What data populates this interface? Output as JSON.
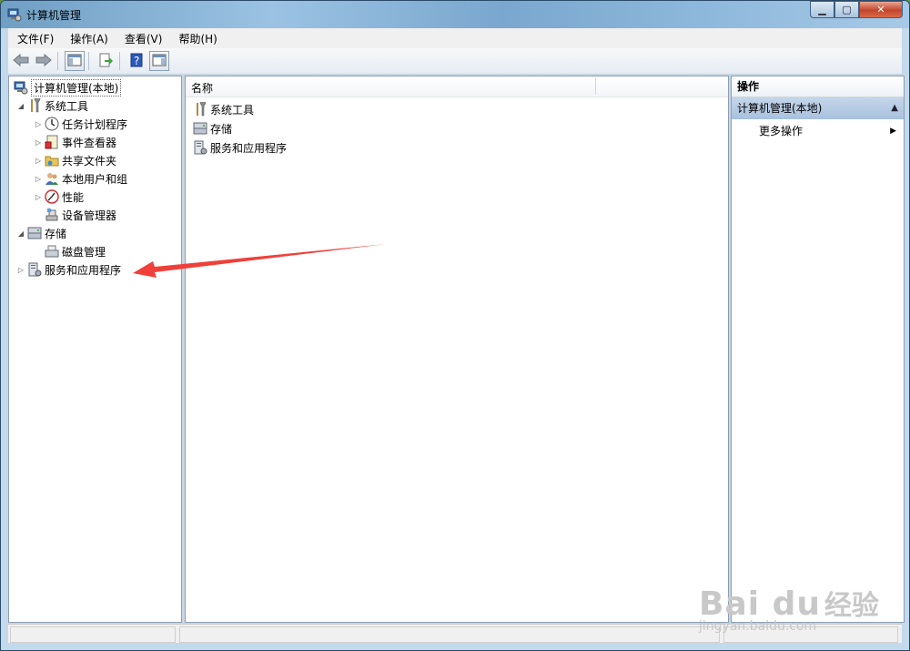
{
  "window": {
    "title": "计算机管理",
    "controls": {
      "minimize": "▁",
      "maximize": "▢",
      "close": "✕"
    }
  },
  "menu": [
    "文件(F)",
    "操作(A)",
    "查看(V)",
    "帮助(H)"
  ],
  "toolbar": {
    "icons": [
      "back-icon",
      "forward-icon",
      "show-hide-tree-icon",
      "export-list-icon",
      "help-icon",
      "show-hide-action-pane-icon"
    ]
  },
  "tree": {
    "root": "计算机管理(本地)",
    "items": [
      {
        "label": "系统工具",
        "expand": "◢",
        "icon": "tools-icon"
      },
      {
        "label": "任务计划程序",
        "expand": "▷",
        "icon": "clock-icon"
      },
      {
        "label": "事件查看器",
        "expand": "▷",
        "icon": "event-viewer-icon"
      },
      {
        "label": "共享文件夹",
        "expand": "▷",
        "icon": "shared-folder-icon"
      },
      {
        "label": "本地用户和组",
        "expand": "▷",
        "icon": "users-icon"
      },
      {
        "label": "性能",
        "expand": "▷",
        "icon": "performance-icon"
      },
      {
        "label": "设备管理器",
        "expand": "",
        "icon": "device-manager-icon"
      },
      {
        "label": "存储",
        "expand": "◢",
        "icon": "storage-icon"
      },
      {
        "label": "磁盘管理",
        "expand": "",
        "icon": "disk-icon"
      },
      {
        "label": "服务和应用程序",
        "expand": "▷",
        "icon": "services-icon"
      }
    ]
  },
  "list": {
    "header": "名称",
    "items": [
      "系统工具",
      "存储",
      "服务和应用程序"
    ]
  },
  "actions": {
    "header": "操作",
    "group": "计算机管理(本地)",
    "group_toggle": "▲",
    "item": "更多操作",
    "item_arrow": "▶"
  },
  "watermark": {
    "logo": "Bai du",
    "cn": "经验",
    "url": "jingyan.baidu.com"
  },
  "colors": {
    "arrow": "#f0403a",
    "selection": "#a8c1de",
    "pane_border": "#8d9fb3"
  }
}
